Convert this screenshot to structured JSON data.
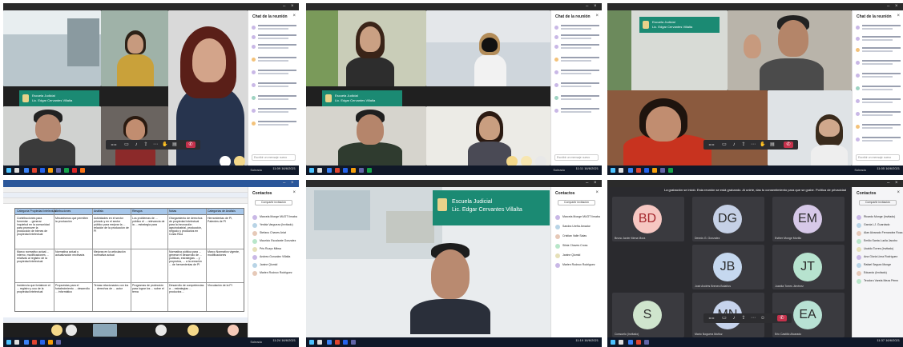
{
  "panel1": {
    "chat_title": "Chat de la reunión",
    "input_placeholder": "Escribir un mensaje nuevo",
    "banner_line1": "Escuela Judicial",
    "banner_line2": "Lic. Edgar Cervantes Villalta"
  },
  "panel2": {
    "chat_title": "Chat de la reunión",
    "input_placeholder": "Escribir un mensaje nuevo",
    "banner_line1": "Escuela Judicial",
    "banner_line2": "Lic. Edgar Cervantes Villalta"
  },
  "panel3": {
    "chat_title": "Chat de la reunión",
    "input_placeholder": "Escribir un mensaje nuevo",
    "banner_line1": "Escuela Judicial",
    "banner_line2": "Lic. Edgar Cervantes Villalta"
  },
  "panel4": {
    "contacts_title": "Contactos",
    "share_label": "Compartir invitación",
    "contacts": [
      "Marcela Monge MUOT Iimaba",
      "Yesbia Vargueza (Invitado)",
      "Stefano Chaves Ariat",
      "Mauricio Escalante Gonzalez",
      "Pris Ruzyx Mitwa",
      "Andrea Gonzalez Villalta",
      "Janine Qiomid",
      "Marlen Rodnux Rodriguez"
    ],
    "table_headers": [
      "Categoría Propiedad Intelectual",
      "Atribuciones",
      "Análisis",
      "Riesgos",
      "Notas",
      "Categorías de Análisis"
    ],
    "row1": [
      "Contribuciones para fomentar ... generar inquietud en la comunidad para promover la producción de bienes de propiedad intelectual",
      "Mecanismos que permiten la producción",
      "Actividades en el sector privado y en el sector público para mejorar la ... relación de la producción de PI",
      "Los problemas de ... público el ... relevancia de la ... estrategia para",
      "Otorgamiento de derechos de propiedad intelectual para la innovación agroindustrial, producción, negocio y productos en Costa Rica",
      "Herramientas de PI, Patentes de PI"
    ],
    "row2": [
      "Marco normativo actual ... interno, modificaciones ... relativas al registro de la propiedad intelectual",
      "Normativa actual y actualización necesaria",
      "Mejoras en la articulación normativa actual",
      "",
      "Normativa pública para ... generar el desarrollo de ... políticas, estrategias ... y proyectos, ... a la creación ... de herramientas de PI",
      "Marco Normativo vigente, modificaciones"
    ],
    "row3": [
      "Incidencia que fortalecer el ... registro y uso de la propiedad intelectual",
      "Propuestas para el fortalecimiento ... desarrollo ... informático",
      "Temas relacionados con los ... derechos de ... autor",
      "Programas de protección para lograr los ... sobre el tema",
      "Desarrollo de competencias a ... estrategias ... productos ... ",
      "Vinculación de la PI"
    ]
  },
  "panel5": {
    "banner_line1": "Escuela Judicial",
    "banner_line2": "Lic. Edgar Cervantes Villalta",
    "contacts_title": "Contactos",
    "share_label": "Compartir invitación",
    "contacts": [
      "Marcela Monge MUOT Iimaba",
      "Sandra Ureña Amador",
      "Cristian Valle Salas",
      "Silvia Chaves Cross",
      "Janine Qiomid",
      "Marlen Rodnux Rodriguez"
    ]
  },
  "panel6": {
    "notice": "La grabación se inició. Esta reunión se está grabando. Al unirte, das tu consentimiento para que se grabe. Política de privacidad",
    "contacts_title": "Contactos",
    "share_label": "Compartir invitación",
    "tiles": [
      {
        "initials": "BD",
        "name": "Bruno Javier Mena Mora",
        "color": "#f6c7c2"
      },
      {
        "initials": "DG",
        "name": "Dennis G. Gonzalez",
        "color": "#c5d0e6"
      },
      {
        "initials": "EM",
        "name": "Esther Monge Murillo",
        "color": "#d6c8e8"
      },
      {
        "initials": "JB",
        "name": "José Andrés Brenes Bolaños",
        "color": "#c5d8ef"
      },
      {
        "initials": "JT",
        "name": "Juanita Torres Jiménez",
        "color": "#b7e3cf"
      },
      {
        "initials": "S",
        "name": "Consuelo (Invitado)",
        "color": "#cfe5cd"
      },
      {
        "initials": "MN",
        "name": "Mario Noguera Muñoz",
        "color": "#c6d3ec"
      },
      {
        "initials": "EA",
        "name": "Eric Castillo Alvarado",
        "color": "#b8e2d4"
      }
    ],
    "contacts": [
      "Ricardo Monge (Invitado)",
      "Garcia LJ. Guardado",
      "Alan Alvarado Fernandez Rosa",
      "Emilio Santa Lucila Jacobo",
      "Ucaldo Torres (Invitado)",
      "Ana Gloria Lima Rodríguez",
      "Rafael Segura Monge",
      "Eduardo (Invitado)",
      "Teodoro Varela Meza Pérez"
    ]
  },
  "taskbar": {
    "clock_p1": "11:09 16/6/2021",
    "clock_p2": "11:11 16/6/2021",
    "clock_p3": "11:05 16/6/2021",
    "clock_p4": "11:24 16/6/2021",
    "clock_p5": "11:19 16/6/2021",
    "clock_p6": "11:37 16/6/2021",
    "weather": "Soleado"
  },
  "colors": {
    "teams_purple": "#6264a7",
    "end_call": "#c4314b",
    "banner_green": "#1b8a73"
  }
}
